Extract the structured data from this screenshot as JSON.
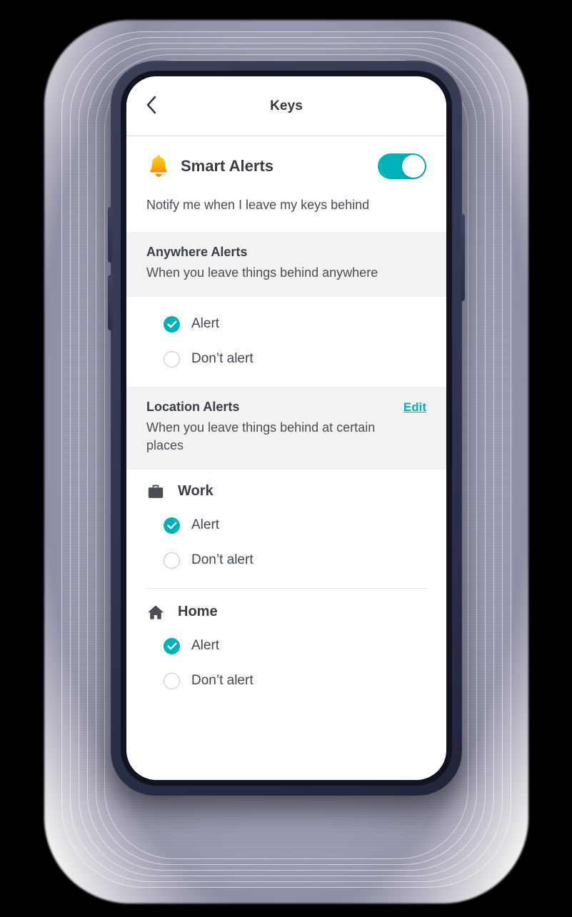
{
  "theme": {
    "accent_teal": "#00b2b8",
    "bell_yellow": "#ffb300",
    "text_dark": "#3a3e44",
    "text_body": "#4a4e54",
    "section_gray": "#f2f2f2",
    "phone_frame": "#333a52",
    "backdrop": "#000000",
    "halo": "#b7b7d6"
  },
  "nav": {
    "back_label": "Back",
    "title": "Keys"
  },
  "smart_alerts": {
    "icon": "bell-icon",
    "title": "Smart Alerts",
    "subtitle": "Notify me when I leave my keys behind",
    "toggle": {
      "state": "on",
      "label": "Smart Alerts toggle"
    }
  },
  "anywhere_alerts": {
    "title": "Anywhere Alerts",
    "subtitle": "When you leave things behind anywhere",
    "options": [
      {
        "label": "Alert",
        "selected": true
      },
      {
        "label": "Don’t alert",
        "selected": false
      }
    ]
  },
  "location_alerts": {
    "title": "Location Alerts",
    "edit_label": "Edit",
    "subtitle": "When you leave things behind at certain places",
    "places": [
      {
        "name": "Work",
        "icon": "briefcase-icon",
        "options": [
          {
            "label": "Alert",
            "selected": true
          },
          {
            "label": "Don’t alert",
            "selected": false
          }
        ]
      },
      {
        "name": "Home",
        "icon": "home-icon",
        "options": [
          {
            "label": "Alert",
            "selected": true
          },
          {
            "label": "Don’t alert",
            "selected": false
          }
        ]
      }
    ]
  }
}
